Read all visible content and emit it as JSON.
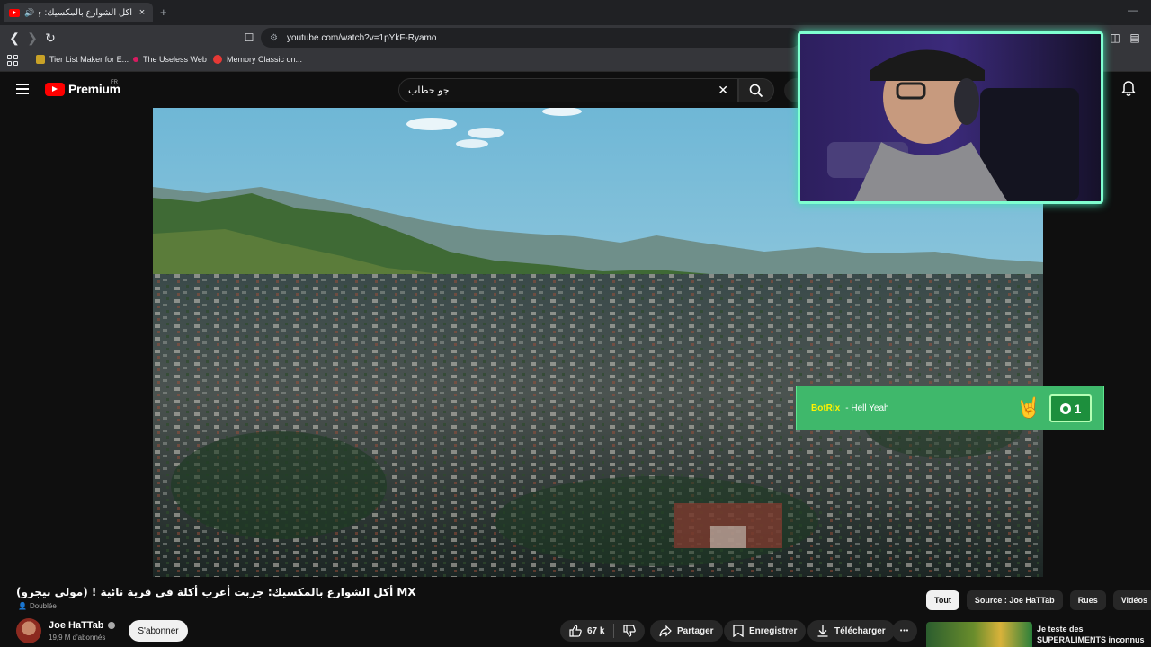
{
  "browser": {
    "tab": {
      "title": "أكل الشوارع بالمكسيك: جربت أ",
      "close": "×"
    },
    "new_tab": "+",
    "window_minimize": "—",
    "address": "youtube.com/watch?v=1pYkF-Ryamo",
    "bookmarks": [
      {
        "label": "Tier List Maker for E...",
        "color": "#c9a227"
      },
      {
        "label": "The Useless Web",
        "color": "#d81b60"
      },
      {
        "label": "Memory Classic on...",
        "color": "#e53935"
      }
    ]
  },
  "youtube": {
    "logo_text": "Premium",
    "region": "FR",
    "search": {
      "value": "جو حطاب"
    }
  },
  "alert": {
    "user": "BotRix",
    "message": "- Hell Yeah",
    "emoji": "🤘",
    "count": "1"
  },
  "video": {
    "title": "أكل الشوارع بالمكسيك: جربت أغرب أكلة في قرية نائية ! (مولي نيجرو) MX",
    "dubbed": "Doublée",
    "channel": "Joe HaTTab",
    "subscribers": "19,9 M d'abonnés",
    "subscribe_label": "S'abonner",
    "likes": "67 k",
    "share_label": "Partager",
    "save_label": "Enregistrer",
    "download_label": "Télécharger",
    "more": "•••"
  },
  "chips": [
    "Tout",
    "Source : Joe HaTTab",
    "Rues",
    "Vidéos"
  ],
  "recommendation": {
    "title": "Je teste des SUPERALIMENTS inconnus dans la jungle ..."
  },
  "colors": {
    "accent": "#ff0000",
    "alert_bg": "#3fb86b",
    "alert_user": "#fff200",
    "webcam_glow": "#7fffd0"
  }
}
